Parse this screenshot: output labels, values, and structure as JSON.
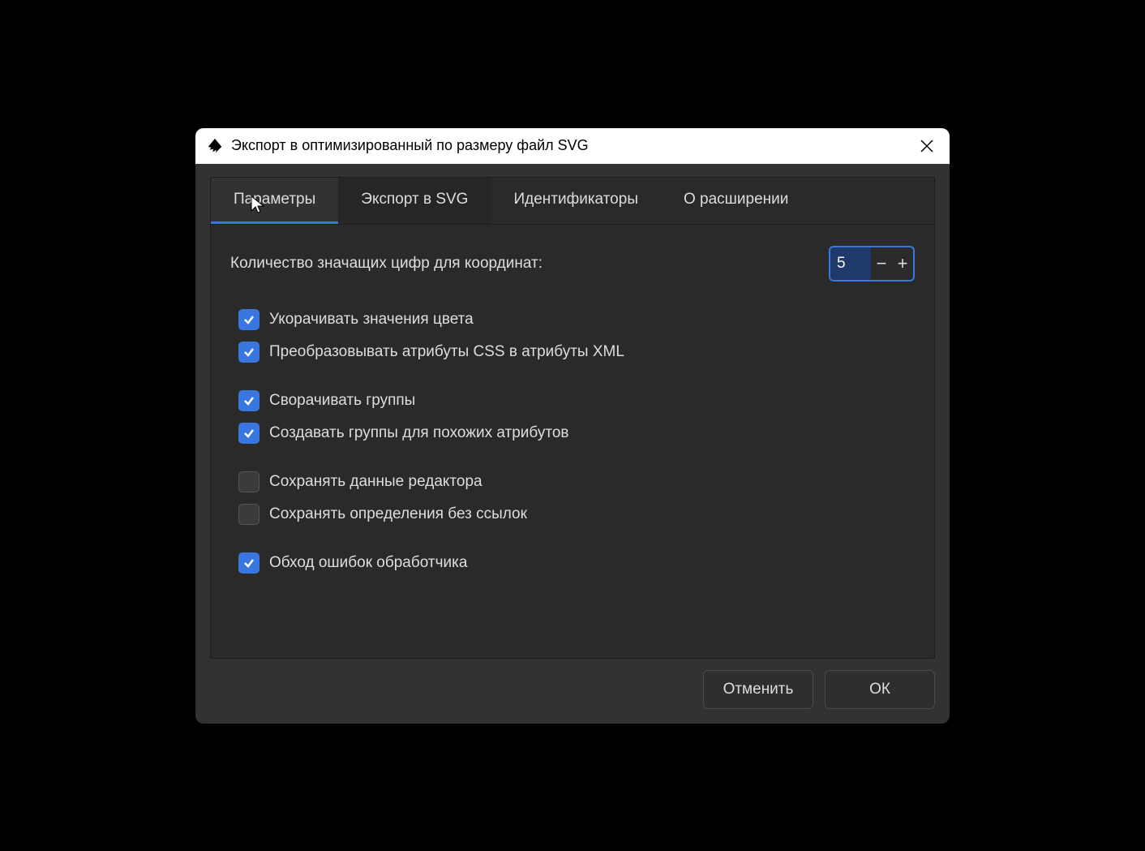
{
  "dialog": {
    "title": "Экспорт в оптимизированный по размеру файл SVG"
  },
  "tabs": {
    "options": "Параметры",
    "export_svg": "Экспорт в SVG",
    "identifiers": "Идентификаторы",
    "about": "О расширении"
  },
  "options": {
    "sig_digits_label": "Количество значащих цифр для координат:",
    "sig_digits_value": "5",
    "shorten_colors": "Укорачивать значения цвета",
    "css_to_xml": "Преобразовывать атрибуты CSS в атрибуты XML",
    "collapse_groups": "Сворачивать группы",
    "create_groups": "Создавать группы для похожих атрибутов",
    "keep_editor_data": "Сохранять данные редактора",
    "keep_unref_defs": "Сохранять определения без ссылок",
    "workaround_bugs": "Обход ошибок обработчика"
  },
  "buttons": {
    "cancel": "Отменить",
    "ok": "ОК"
  },
  "spinner": {
    "minus": "−",
    "plus": "+"
  }
}
